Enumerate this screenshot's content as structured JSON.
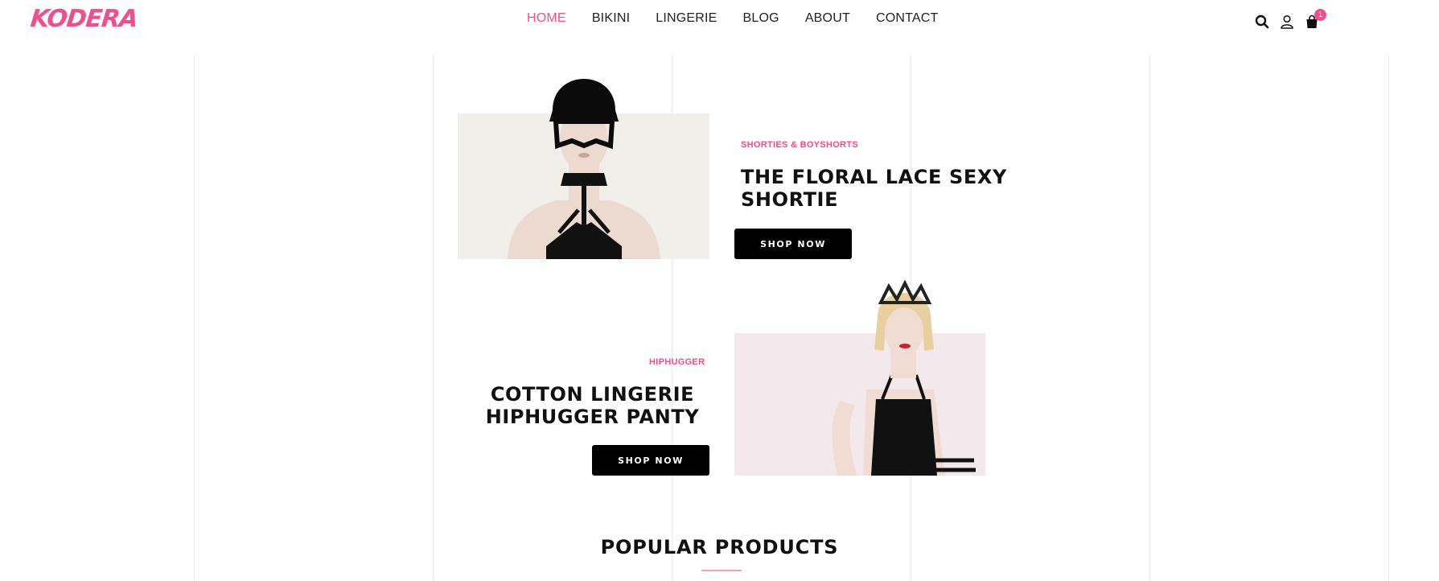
{
  "brand": {
    "logo_text": "KODERA",
    "accent_color": "#ef4f8f"
  },
  "nav": {
    "items": [
      {
        "label": "HOME",
        "active": true
      },
      {
        "label": "BIKINI",
        "active": false
      },
      {
        "label": "LINGERIE",
        "active": false
      },
      {
        "label": "BLOG",
        "active": false
      },
      {
        "label": "ABOUT",
        "active": false
      },
      {
        "label": "CONTACT",
        "active": false
      }
    ]
  },
  "header_icons": {
    "search": "search-icon",
    "account": "user-icon",
    "cart": "shopping-bag-icon",
    "cart_count": "1"
  },
  "banners": [
    {
      "category": "SHORTIES & BOYSHORTS",
      "title_line1": "THE FLORAL LACE SEXY",
      "title_line2": "SHORTIE",
      "button_label": "SHOP NOW",
      "image_bg": "#f0efea"
    },
    {
      "category": "HIPHUGGER",
      "title_line1": "COTTON LINGERIE",
      "title_line2": "HIPHUGGER PANTY",
      "button_label": "SHOP NOW",
      "image_bg": "#f3e8ec"
    }
  ],
  "popular": {
    "title": "POPULAR PRODUCTS"
  }
}
